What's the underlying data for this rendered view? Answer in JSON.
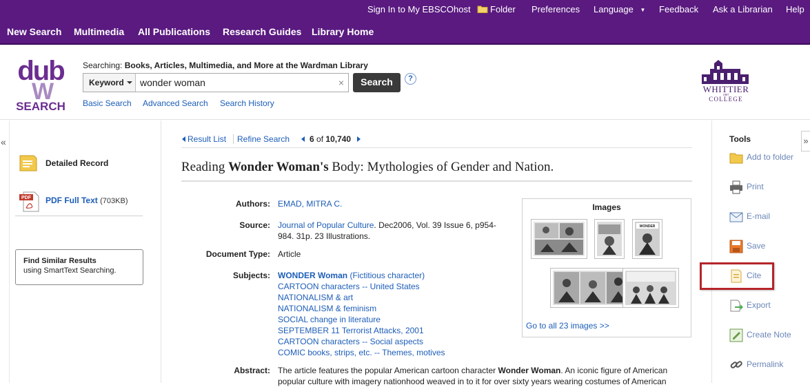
{
  "topbar": {
    "signin": "Sign In to My EBSCOhost",
    "folder": "Folder",
    "preferences": "Preferences",
    "language": "Language",
    "feedback": "Feedback",
    "ask": "Ask a Librarian",
    "help": "Help"
  },
  "nav": {
    "items": [
      "New Search",
      "Multimedia",
      "All Publications",
      "Research Guides",
      "Library Home"
    ]
  },
  "logo": {
    "line1": "dub",
    "line2": "SEARCH",
    "brand_color": "#6b2d90"
  },
  "college": {
    "name1": "WHITTIER",
    "year": "1887",
    "name2": "COLLEGE"
  },
  "search": {
    "searching_prefix": "Searching:",
    "searching_scope": "Books, Articles, Multimedia, and More at the Wardman Library",
    "field": "Keyword",
    "query": "wonder woman",
    "clear": "×",
    "button": "Search",
    "help": "?",
    "links": [
      "Basic Search",
      "Advanced Search",
      "Search History"
    ]
  },
  "left": {
    "collapse": "«",
    "detailed_record": "Detailed Record",
    "pdf_label": "PDF Full Text",
    "pdf_size": "(703KB)",
    "similar_title": "Find Similar Results",
    "similar_sub": "using SmartText Searching."
  },
  "results_nav": {
    "result_list": "Result List",
    "refine": "Refine Search",
    "position": "6",
    "of": "of",
    "total": "10,740"
  },
  "record": {
    "title_pre": "Reading ",
    "title_bold": "Wonder Woman's",
    "title_post": " Body: Mythologies of Gender and Nation.",
    "authors_label": "Authors:",
    "authors": "EMAD, MITRA C.",
    "source_label": "Source:",
    "source_journal": "Journal of Popular Culture",
    "source_rest1": ". Dec2006, Vol. 39 Issue 6, p954-",
    "source_rest2": "984. 31p. 23 Illustrations.",
    "doctype_label": "Document Type:",
    "doctype": "Article",
    "subjects_label": "Subjects:",
    "subject_first_bold": "WONDER Woman",
    "subject_first_rest": " (Fictitious character)",
    "subjects": [
      "CARTOON characters -- United States",
      "NATIONALISM & art",
      "NATIONALISM & feminism",
      "SOCIAL change in literature",
      "SEPTEMBER 11 Terrorist Attacks, 2001",
      "CARTOON characters -- Social aspects",
      "COMIC books, strips, etc. -- Themes, motives"
    ],
    "abstract_label": "Abstract:",
    "abstract_pre": "The article features the popular American cartoon character ",
    "abstract_bold": "Wonder Woman",
    "abstract_post": ". An iconic figure of American popular culture with imagery nationhood weaved in to it for over sixty years wearing costumes of American"
  },
  "images": {
    "title": "Images",
    "goto": "Go to all 23 images >>"
  },
  "tools": {
    "heading": "Tools",
    "items": [
      {
        "label": "Add to folder",
        "icon": "folder-icon"
      },
      {
        "label": "Print",
        "icon": "printer-icon"
      },
      {
        "label": "E-mail",
        "icon": "email-icon"
      },
      {
        "label": "Save",
        "icon": "save-icon"
      },
      {
        "label": "Cite",
        "icon": "cite-icon"
      },
      {
        "label": "Export",
        "icon": "export-icon"
      },
      {
        "label": "Create Note",
        "icon": "note-icon"
      },
      {
        "label": "Permalink",
        "icon": "link-icon"
      }
    ],
    "expand": "»"
  }
}
